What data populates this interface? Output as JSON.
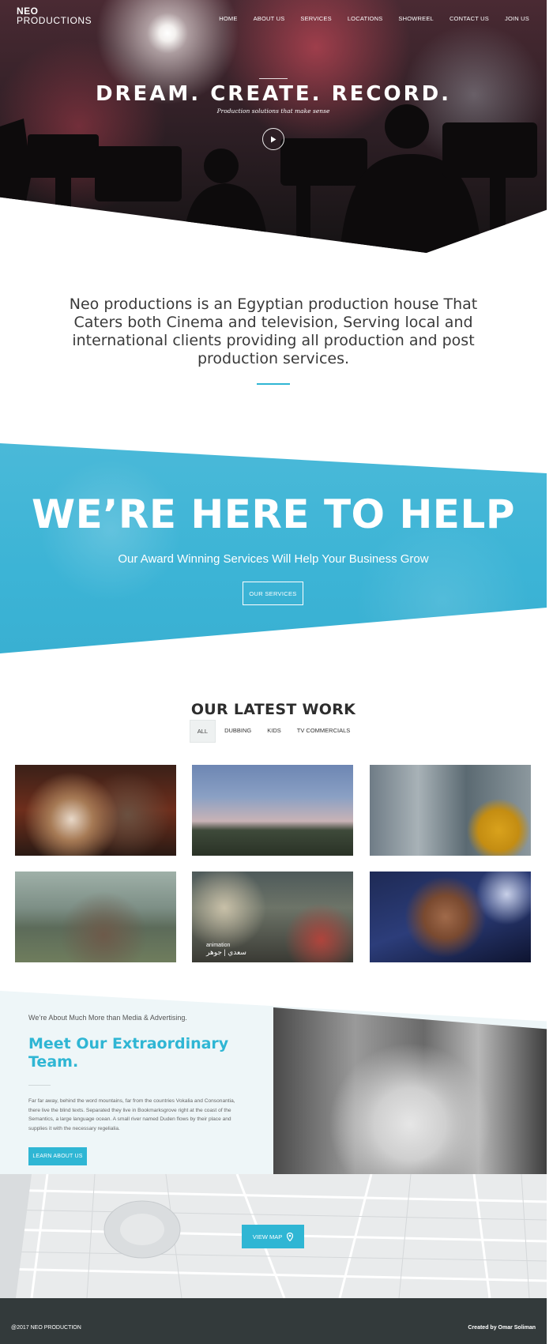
{
  "brand": {
    "line1": "NEO",
    "line2": "PRODUCTIONS"
  },
  "nav": [
    {
      "label": "HOME"
    },
    {
      "label": "ABOUT US"
    },
    {
      "label": "SERVICES"
    },
    {
      "label": "LOCATIONS"
    },
    {
      "label": "SHOWREEL"
    },
    {
      "label": "CONTACT US"
    },
    {
      "label": "JOIN US"
    }
  ],
  "hero": {
    "title": "DREAM. CREATE. RECORD.",
    "subtitle": "Production solutions that make sense",
    "play_icon": "play-icon"
  },
  "intro": {
    "text": "Neo productions is an Egyptian production house That Caters both Cinema and television, Serving local and international clients providing all production and post production services."
  },
  "help": {
    "title": "WE’RE HERE TO HELP",
    "subtitle": "Our Award Winning Services Will Help Your Business Grow",
    "button": "OUR SERVICES"
  },
  "work": {
    "title": "OUR LATEST WORK",
    "filters": [
      {
        "label": "ALL",
        "active": true
      },
      {
        "label": "DUBBING",
        "active": false
      },
      {
        "label": "KIDS",
        "active": false
      },
      {
        "label": "TV COMMERCIALS",
        "active": false
      }
    ],
    "items": [
      {
        "caption": ""
      },
      {
        "caption": ""
      },
      {
        "caption": ""
      },
      {
        "caption": ""
      },
      {
        "caption_line1": "animation",
        "caption_line2": "سعدي | جوهر"
      },
      {
        "caption": ""
      }
    ]
  },
  "about": {
    "eyebrow": "We’re About Much More than Media & Advertising.",
    "title": "Meet Our Extraordinary Team.",
    "body": "Far far away, behind the word mountains, far from the countries Vokalia and Consonantia, there live the blind texts. Separated they live in Bookmarksgrove right at the coast of the Semantics, a large language ocean. A small river named Duden flows by their place and supplies it with the necessary regelialia.",
    "button": "LEARN ABOUT US"
  },
  "map": {
    "button": "VIEW MAP",
    "icon": "map-pin-icon"
  },
  "footer": {
    "copyright": "@2017 NEO PRODUCTION",
    "credit": "Created by Omar Soliman"
  },
  "colors": {
    "accent": "#2fb6d4",
    "footer": "#333a3b",
    "about_bg": "#eef6f8"
  }
}
